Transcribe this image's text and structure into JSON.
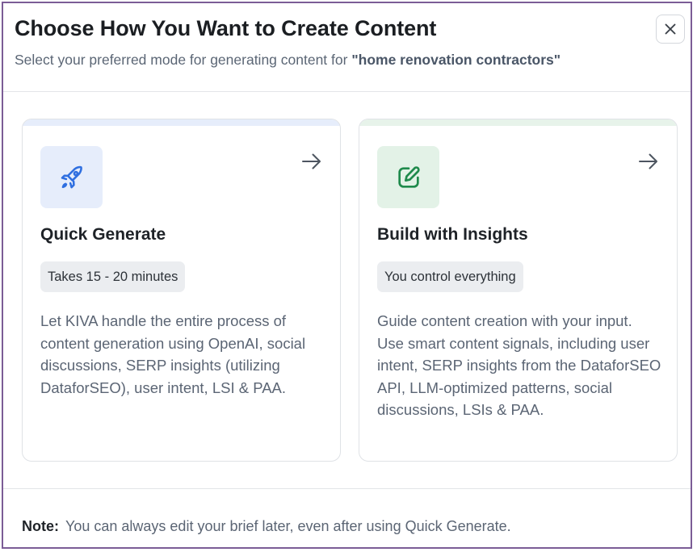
{
  "header": {
    "title": "Choose How You Want to Create Content",
    "subtitle_prefix": "Select your preferred mode for generating content for ",
    "keyword": "\"home renovation contractors\"",
    "close_icon": "close-icon"
  },
  "options": [
    {
      "icon": "rocket-icon",
      "arrow_icon": "arrow-right-icon",
      "title": "Quick Generate",
      "badge": "Takes 15 - 20 minutes",
      "description": "Let KIVA handle the entire process of content generation using OpenAI, social discussions, SERP insights (utilizing DataforSEO), user intent, LSI & PAA.",
      "accent_bg": "#e6edfb",
      "icon_color": "#2f6fe0"
    },
    {
      "icon": "edit-square-icon",
      "arrow_icon": "arrow-right-icon",
      "title": "Build with Insights",
      "badge": "You control everything",
      "description": "Guide content creation with your input. Use smart content signals, including user intent, SERP insights from the DataforSEO API, LLM-optimized patterns, social discussions, LSIs & PAA.",
      "accent_bg": "#e3f2e7",
      "icon_color": "#1f8a4c"
    }
  ],
  "footer": {
    "note_label": "Note:",
    "note_text": "You can always edit your brief later, even after using Quick Generate."
  },
  "colors": {
    "border": "#7b5c96",
    "text_primary": "#1b1e22",
    "text_secondary": "#5b6675"
  }
}
